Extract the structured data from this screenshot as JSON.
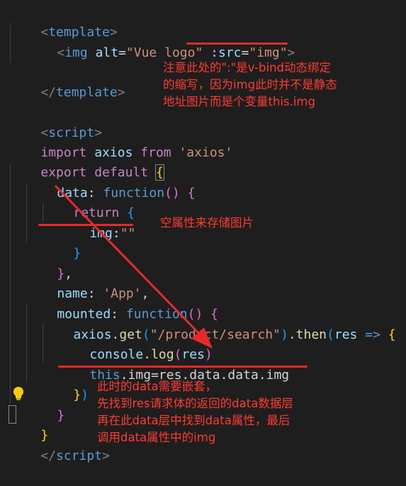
{
  "code": {
    "l1_open": "<",
    "l1_tag": "template",
    "l1_close": ">",
    "l2_open": "<",
    "l2_tag": "img",
    "l2_attr1": "alt",
    "l2_eq1": "=",
    "l2_val1": "\"Vue logo\"",
    "l2_attr2": ":src",
    "l2_eq2": "=",
    "l2_val2": "\"img\"",
    "l2_close": ">",
    "l3_open": "</",
    "l3_tag": "template",
    "l3_close": ">",
    "l4_open": "<",
    "l4_tag": "script",
    "l4_close": ">",
    "l5_kw": "import",
    "l5_name": "axios",
    "l5_from": "from",
    "l5_str": "'axios'",
    "l6_kw1": "export",
    "l6_kw2": "default",
    "l6_brace": "{",
    "l7_prop": "data",
    "l7_colon": ":",
    "l7_fn": "function",
    "l7_paren": "()",
    "l7_brace": "{",
    "l8_kw": "return",
    "l8_brace": "{",
    "l9_prop": "img",
    "l9_colon": ":",
    "l9_str": "\"\"",
    "l10_brace": "}",
    "l11_brace": "}",
    "l11_comma": ",",
    "l12_prop": "name",
    "l12_colon": ":",
    "l12_str": "'App'",
    "l12_comma": ",",
    "l13_prop": "mounted",
    "l13_colon": ":",
    "l13_fn": "function",
    "l13_paren": "()",
    "l13_brace": "{",
    "l14_obj": "axios",
    "l14_dot": ".",
    "l14_get": "get",
    "l14_p1": "(",
    "l14_str": "\"/product/search\"",
    "l14_p2": ")",
    "l14_dot2": ".",
    "l14_then": "then",
    "l14_p3": "(",
    "l14_res": "res",
    "l14_arrow": "=>",
    "l14_brace": "{",
    "l15_obj": "console",
    "l15_dot": ".",
    "l15_fn": "log",
    "l15_p1": "(",
    "l15_res": "res",
    "l15_p2": ")",
    "l16_this": "this",
    "l16_rest": ".img=res.data.data.img",
    "l17_brace": "}",
    "l17_paren": ")",
    "l18_brace": "}",
    "l19_brace": "}",
    "l20_open": "</",
    "l20_tag": "script",
    "l20_close": ">"
  },
  "annotations": {
    "note1": "注意此处的\":\"是v-bind动态绑定\n的缩写，因为img此时并不是静态\n地址图片而是个变量this.img",
    "note2": "空属性来存储图片",
    "note3": "此时的data需要嵌套，\n先找到res请求体的返回的data数据层\n再在此data层中找到data属性，最后\n调用data属性中的img"
  },
  "colors": {
    "background": "#1e1e1e",
    "annotation": "#e52a2a",
    "keyword": "#c586c0",
    "tag": "#569cd6",
    "string": "#ce9178"
  },
  "icons": [
    "lightbulb-icon"
  ]
}
